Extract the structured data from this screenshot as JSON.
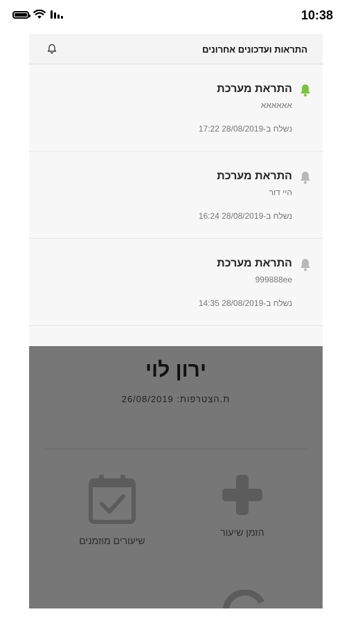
{
  "status_bar": {
    "time": "10:38",
    "icons": [
      "battery-icon",
      "wifi-icon",
      "signal-icon"
    ]
  },
  "panel": {
    "title": "התראות ועדכונים אחרונים",
    "header_icon": "bell-icon",
    "notifications": [
      {
        "title": "התראת מערכת",
        "body": "אאאאאא",
        "sent": "נשלח ב-28/08/2019 17:22",
        "icon": "bell-icon",
        "icon_color": "#7cc242",
        "unread": true
      },
      {
        "title": "התראת מערכת",
        "body": "היי דור",
        "sent": "נשלח ב-28/08/2019 16:24",
        "icon": "bell-icon",
        "icon_color": "#b9b9b9",
        "unread": false
      },
      {
        "title": "התראת מערכת",
        "body": "999888ee",
        "sent": "נשלח ב-28/08/2019 14:35",
        "icon": "bell-icon",
        "icon_color": "#b9b9b9",
        "unread": false
      }
    ]
  },
  "profile": {
    "name": "ירון לוי",
    "joined": "ת.הצטרפות: 26/08/2019",
    "actions": [
      {
        "label": "הזמן שיעור",
        "icon": "plus-icon"
      },
      {
        "label": "שיעורים מוזמנים",
        "icon": "calendar-check-icon"
      }
    ]
  },
  "colors": {
    "overlay": "#777777",
    "bell_active": "#7cc242",
    "bell_inactive": "#b9b9b9"
  }
}
